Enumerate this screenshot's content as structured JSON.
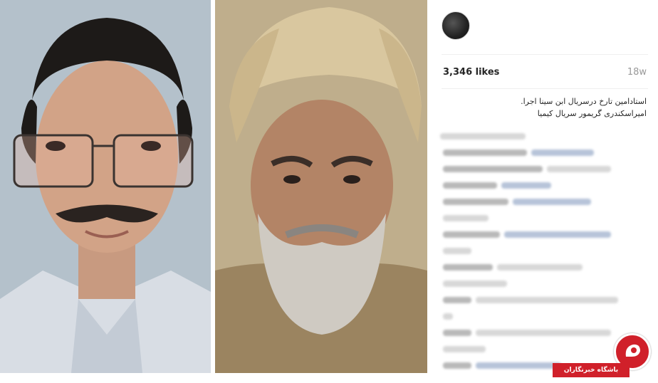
{
  "post": {
    "likes": "3,346 likes",
    "age": "18w",
    "caption_line1": "استادامین تارخ درسریال ابن سینا اجرا.",
    "caption_line2": "امیراسکندری گریمور سریال کیمیا"
  },
  "watermark": {
    "site_name": "باشگاه خبرنگاران",
    "brand_color": "#d0202a"
  },
  "icons": {
    "avatar": "profile-avatar",
    "logo": "brand-logo"
  }
}
